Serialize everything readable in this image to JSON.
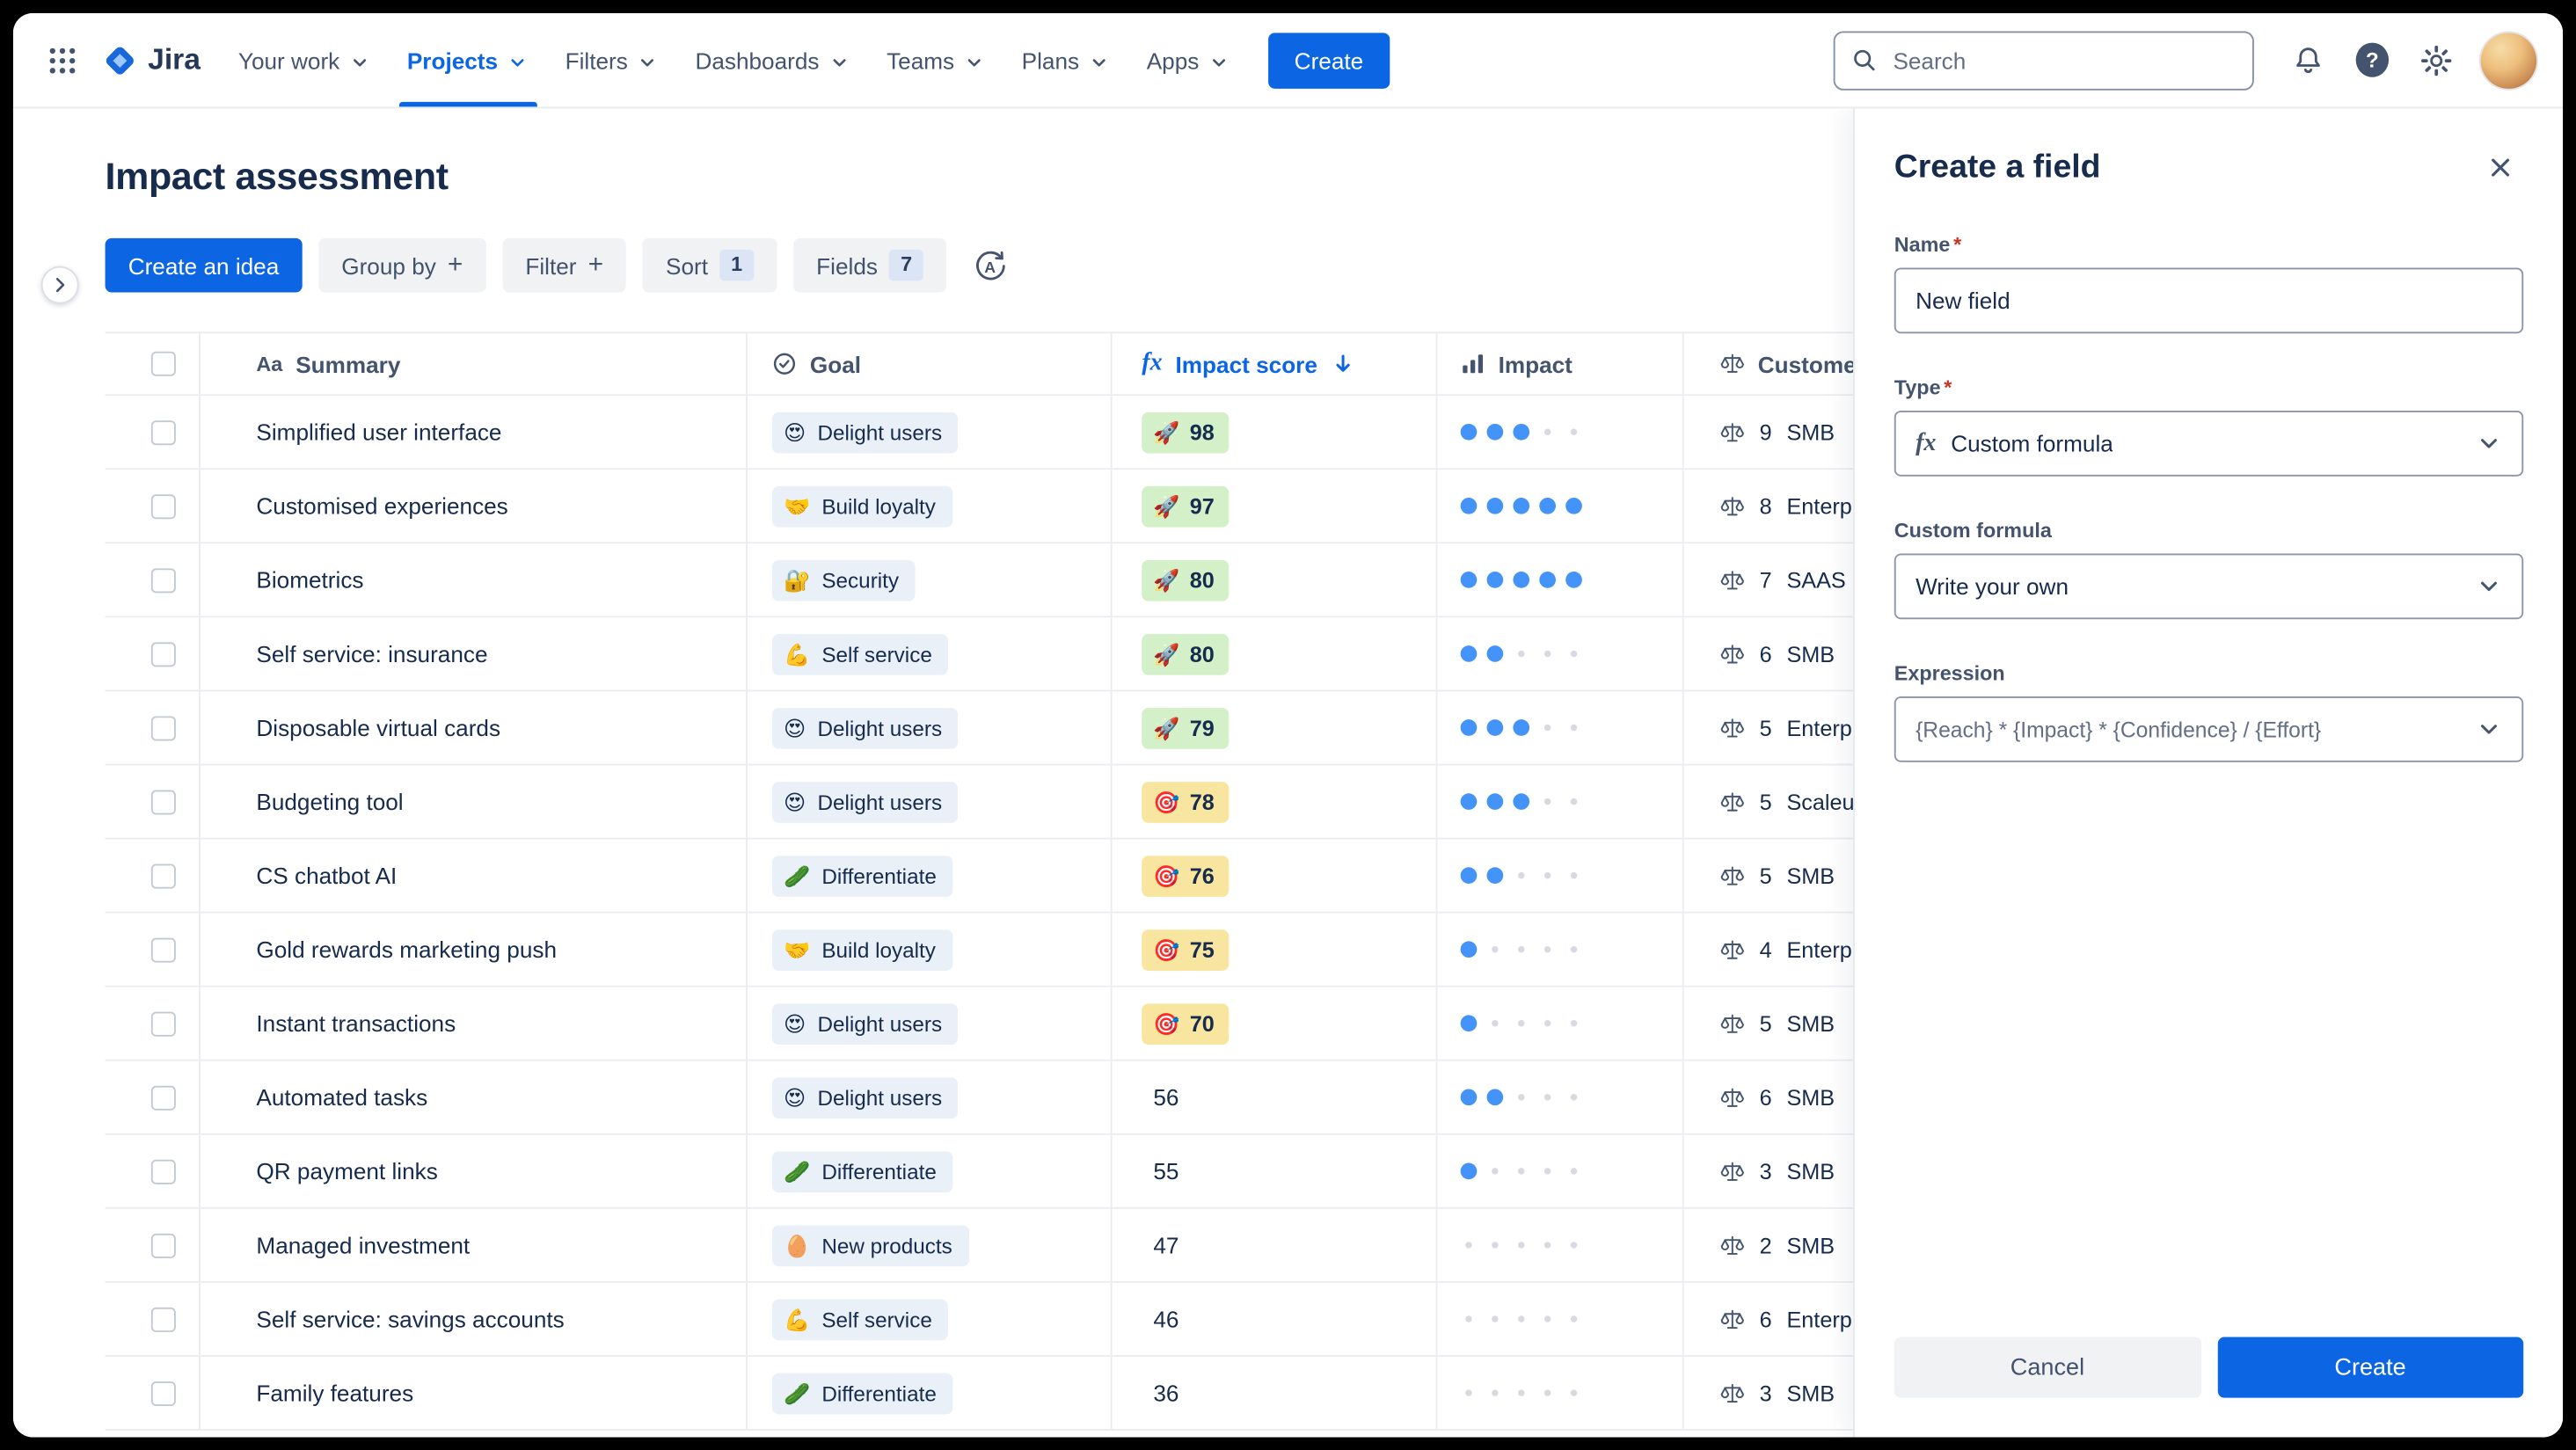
{
  "colors": {
    "accent": "#0C66E4",
    "text": "#172B4D",
    "text_subtle": "#44546F",
    "muted": "#626F86",
    "grid": "#EBECF0",
    "pill_bg": "#E9F0F7",
    "score_green": "#D3F0C8",
    "score_yellow": "#F8E6A0",
    "dot_blue": "#4493F8",
    "dot_empty": "#D7DBE1",
    "btn_subtle": "#F1F2F4",
    "count_badge": "#DBE5F6",
    "danger": "#CA3521"
  },
  "icons": {
    "plus": "+",
    "aa": "Aa",
    "fx": "fx"
  },
  "navbar": {
    "logo_text": "Jira",
    "items": [
      {
        "label": "Your work"
      },
      {
        "label": "Projects",
        "active": true
      },
      {
        "label": "Filters"
      },
      {
        "label": "Dashboards"
      },
      {
        "label": "Teams"
      },
      {
        "label": "Plans"
      },
      {
        "label": "Apps"
      }
    ],
    "create_button": "Create",
    "search_placeholder": "Search"
  },
  "page": {
    "title": "Impact assessment",
    "toolbar": {
      "create_idea": "Create an idea",
      "group_by": "Group by",
      "filter": "Filter",
      "sort": "Sort",
      "sort_count": "1",
      "fields": "Fields",
      "fields_count": "7"
    }
  },
  "table": {
    "columns": [
      {
        "label": "Summary"
      },
      {
        "label": "Goal"
      },
      {
        "label": "Impact score",
        "sorted": "desc"
      },
      {
        "label": "Impact"
      },
      {
        "label": "Customer"
      }
    ],
    "rows": [
      {
        "summary": "Simplified user interface",
        "goal_emoji": "😍",
        "goal": "Delight users",
        "score": 98,
        "score_style": "green",
        "score_emoji": "🚀",
        "impact_dots": 3,
        "customer_count": 9,
        "customer": "SMB"
      },
      {
        "summary": "Customised experiences",
        "goal_emoji": "🤝",
        "goal": "Build loyalty",
        "score": 97,
        "score_style": "green",
        "score_emoji": "🚀",
        "impact_dots": 5,
        "customer_count": 8,
        "customer": "Enterprise"
      },
      {
        "summary": "Biometrics",
        "goal_emoji": "🔐",
        "goal": "Security",
        "score": 80,
        "score_style": "green",
        "score_emoji": "🚀",
        "impact_dots": 5,
        "customer_count": 7,
        "customer": "SAAS"
      },
      {
        "summary": "Self service: insurance",
        "goal_emoji": "💪",
        "goal": "Self service",
        "score": 80,
        "score_style": "green",
        "score_emoji": "🚀",
        "impact_dots": 2,
        "customer_count": 6,
        "customer": "SMB"
      },
      {
        "summary": "Disposable virtual cards",
        "goal_emoji": "😍",
        "goal": "Delight users",
        "score": 79,
        "score_style": "green",
        "score_emoji": "🚀",
        "impact_dots": 3,
        "customer_count": 5,
        "customer": "Enterprise"
      },
      {
        "summary": "Budgeting tool",
        "goal_emoji": "😍",
        "goal": "Delight users",
        "score": 78,
        "score_style": "yellow",
        "score_emoji": "🎯",
        "impact_dots": 3,
        "customer_count": 5,
        "customer": "Scaleup"
      },
      {
        "summary": "CS chatbot AI",
        "goal_emoji": "🥒",
        "goal": "Differentiate",
        "score": 76,
        "score_style": "yellow",
        "score_emoji": "🎯",
        "impact_dots": 2,
        "customer_count": 5,
        "customer": "SMB"
      },
      {
        "summary": "Gold rewards marketing push",
        "goal_emoji": "🤝",
        "goal": "Build loyalty",
        "score": 75,
        "score_style": "yellow",
        "score_emoji": "🎯",
        "impact_dots": 1,
        "customer_count": 4,
        "customer": "Enterprise"
      },
      {
        "summary": "Instant transactions",
        "goal_emoji": "😍",
        "goal": "Delight users",
        "score": 70,
        "score_style": "yellow",
        "score_emoji": "🎯",
        "impact_dots": 1,
        "customer_count": 5,
        "customer": "SMB"
      },
      {
        "summary": "Automated tasks",
        "goal_emoji": "😍",
        "goal": "Delight users",
        "score": 56,
        "score_style": "plain",
        "impact_dots": 2,
        "customer_count": 6,
        "customer": "SMB"
      },
      {
        "summary": "QR payment links",
        "goal_emoji": "🥒",
        "goal": "Differentiate",
        "score": 55,
        "score_style": "plain",
        "impact_dots": 1,
        "customer_count": 3,
        "customer": "SMB"
      },
      {
        "summary": "Managed investment",
        "goal_emoji": "🥚",
        "goal": "New products",
        "score": 47,
        "score_style": "plain",
        "impact_dots": 0,
        "customer_count": 2,
        "customer": "SMB"
      },
      {
        "summary": "Self service: savings accounts",
        "goal_emoji": "💪",
        "goal": "Self service",
        "score": 46,
        "score_style": "plain",
        "impact_dots": 0,
        "customer_count": 6,
        "customer": "Enterprise"
      },
      {
        "summary": "Family features",
        "goal_emoji": "🥒",
        "goal": "Differentiate",
        "score": 36,
        "score_style": "plain",
        "impact_dots": 0,
        "customer_count": 3,
        "customer": "SMB"
      }
    ]
  },
  "panel": {
    "title": "Create a field",
    "name_label": "Name",
    "name_value": "New field",
    "type_label": "Type",
    "type_value": "Custom formula",
    "formula_label": "Custom formula",
    "formula_value": "Write your own",
    "expression_label": "Expression",
    "expression_value": "{Reach} * {Impact} * {Confidence} / {Effort}",
    "cancel": "Cancel",
    "create": "Create"
  }
}
